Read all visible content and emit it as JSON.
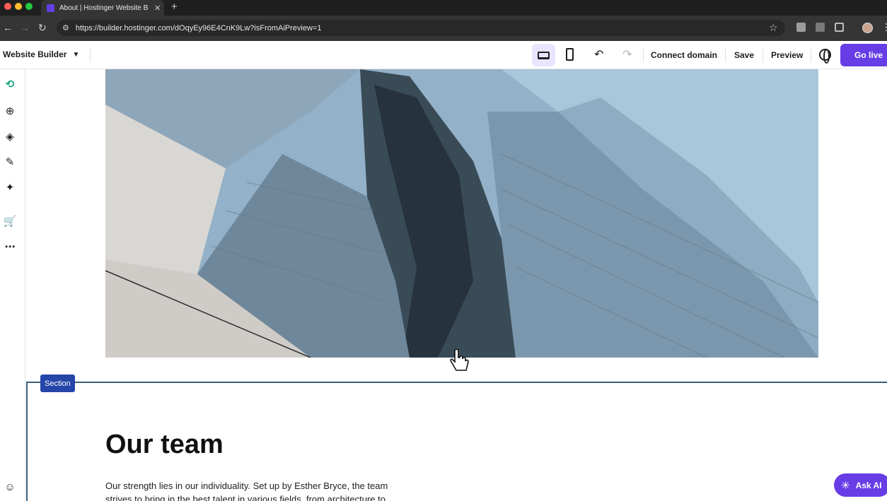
{
  "browser": {
    "tab_title": "About | Hostinger Website Bu",
    "url": "https://builder.hostinger.com/dOqyEy96E4CnK9Lw?isFromAiPreview=1"
  },
  "toolbar": {
    "brand": "Website Builder",
    "connect_domain": "Connect domain",
    "save": "Save",
    "preview": "Preview",
    "go_live": "Go live"
  },
  "sidebar": {
    "items": [
      "logo-icon",
      "add-element-icon",
      "layers-icon",
      "styles-icon",
      "ai-tools-icon",
      "store-icon",
      "more-icon",
      "help-icon"
    ]
  },
  "canvas": {
    "section_label": "Section",
    "team_title": "Our team",
    "team_text": "Our strength lies in our individuality. Set up by Esther Bryce, the team strives to bring in the best talent in various fields, from architecture to"
  },
  "assistant": {
    "ask_ai": "Ask AI"
  },
  "colors": {
    "brand": "#673de6",
    "section_tag": "#2545a8"
  }
}
